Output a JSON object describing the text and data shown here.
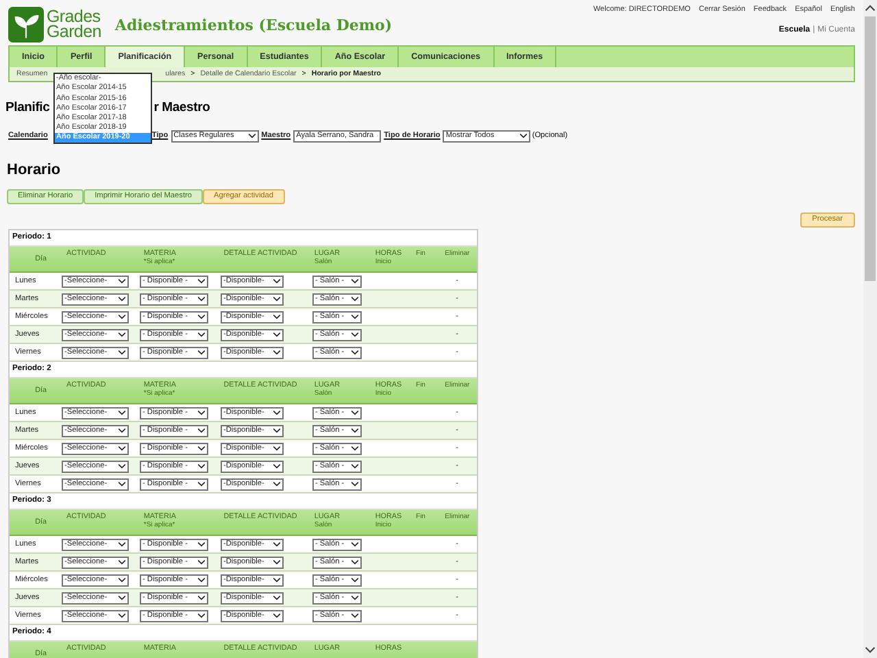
{
  "header": {
    "logo_lines": [
      "Grades",
      "Garden"
    ],
    "school_title": "Adiestramientos (Escuela Demo)",
    "top_links": [
      "Welcome: DIRECTORDEMO",
      "Cerrar Sesión",
      "Feedback",
      "Español",
      "English"
    ],
    "account_links": [
      {
        "text": "Escuela",
        "selected": true
      },
      {
        "text": "|",
        "selected": false
      },
      {
        "text": "Mi Cuenta",
        "selected": false
      }
    ]
  },
  "nav": {
    "tabs": [
      {
        "label": "Inicio",
        "selected": false
      },
      {
        "label": "Perfil",
        "selected": false
      },
      {
        "label": "Planificación",
        "selected": true
      },
      {
        "label": "Personal",
        "selected": false
      },
      {
        "label": "Estudiantes",
        "selected": false
      },
      {
        "label": "Año Escolar",
        "selected": false
      },
      {
        "label": "Comunicaciones",
        "selected": false
      },
      {
        "label": "Informes",
        "selected": false
      }
    ]
  },
  "breadcrumb": [
    {
      "text": "Resumen",
      "kind": "link"
    },
    {
      "text": "ulares",
      "kind": "link"
    },
    {
      "text": ">",
      "kind": "separator"
    },
    {
      "text": "Detalle de Calendario Escolar",
      "kind": "link"
    },
    {
      "text": ">",
      "kind": "separator"
    },
    {
      "text": "Horario por Maestro",
      "kind": "current"
    }
  ],
  "calendar_dropdown": {
    "options": [
      {
        "label": "-Año escolar-",
        "selected": false
      },
      {
        "label": "Año Escolar 2014-15",
        "selected": false
      },
      {
        "label": "Año Escolar 2015-16",
        "selected": false
      },
      {
        "label": "Año Escolar 2016-17",
        "selected": false
      },
      {
        "label": "Año Escolar 2017-18",
        "selected": false
      },
      {
        "label": "Año Escolar 2018-19",
        "selected": false
      },
      {
        "label": "Año Escolar 2019-20",
        "selected": true
      }
    ]
  },
  "page_title_parts": [
    "Planific",
    "r Maestro"
  ],
  "filters": [
    {
      "label": "Calendario",
      "kind": "open"
    },
    {
      "label": "Tipo",
      "kind": "select",
      "value": "Clases Regulares"
    },
    {
      "label": "Maestro",
      "kind": "select",
      "value": "Ayala Serrano, Sandra"
    },
    {
      "label": "Tipo de Horario",
      "kind": "select",
      "value": "Mostrar Todos",
      "note": "(Opcional)"
    }
  ],
  "section_title": "Horario",
  "buttons": [
    {
      "label": "Eliminar Horario",
      "kind": "green"
    },
    {
      "label": "Imprimir Horario del Maestro",
      "kind": "green"
    },
    {
      "label": "Agregar actividad",
      "kind": "orange"
    }
  ],
  "process_button": "Procesar",
  "periods": [
    {
      "label": "Periodo: 1",
      "columns": [
        {
          "title": "Día"
        },
        {
          "title": "ACTIVIDAD"
        },
        {
          "title": "MATERIA",
          "subtitle": "*Si aplica*"
        },
        {
          "title": "DETALLE ACTIVIDAD"
        },
        {
          "title": "LUGAR",
          "subtitle": "Salón"
        },
        {
          "title": "HORAS",
          "subtitle": "Inicio"
        },
        {
          "subtitle": "Fin"
        },
        {
          "subtitle": "Eliminar"
        }
      ],
      "rows": [
        {
          "day": "Lunes",
          "actividad": "-Seleccione-",
          "materia": "- Disponible -",
          "detalle": "-Disponible-",
          "lugar": "- Salón -",
          "eliminar": "-"
        },
        {
          "day": "Martes",
          "actividad": "-Seleccione-",
          "materia": "- Disponible -",
          "detalle": "-Disponible-",
          "lugar": "- Salón -",
          "eliminar": "-"
        },
        {
          "day": "Miércoles",
          "actividad": "-Seleccione-",
          "materia": "- Disponible -",
          "detalle": "-Disponible-",
          "lugar": "- Salón -",
          "eliminar": "-"
        },
        {
          "day": "Jueves",
          "actividad": "-Seleccione-",
          "materia": "- Disponible -",
          "detalle": "-Disponible-",
          "lugar": "- Salón -",
          "eliminar": "-"
        },
        {
          "day": "Viernes",
          "actividad": "-Seleccione-",
          "materia": "- Disponible -",
          "detalle": "-Disponible-",
          "lugar": "- Salón -",
          "eliminar": "-"
        }
      ]
    },
    {
      "label": "Periodo: 2",
      "columns": [
        {
          "title": "Día"
        },
        {
          "title": "ACTIVIDAD"
        },
        {
          "title": "MATERIA",
          "subtitle": "*Si aplica*"
        },
        {
          "title": "DETALLE ACTIVIDAD"
        },
        {
          "title": "LUGAR",
          "subtitle": "Salón"
        },
        {
          "title": "HORAS",
          "subtitle": "Inicio"
        },
        {
          "subtitle": "Fin"
        },
        {
          "subtitle": "Eliminar"
        }
      ],
      "rows": [
        {
          "day": "Lunes",
          "actividad": "-Seleccione-",
          "materia": "- Disponible -",
          "detalle": "-Disponible-",
          "lugar": "- Salón -",
          "eliminar": "-"
        },
        {
          "day": "Martes",
          "actividad": "-Seleccione-",
          "materia": "- Disponible -",
          "detalle": "-Disponible-",
          "lugar": "- Salón -",
          "eliminar": "-"
        },
        {
          "day": "Miércoles",
          "actividad": "-Seleccione-",
          "materia": "- Disponible -",
          "detalle": "-Disponible-",
          "lugar": "- Salón -",
          "eliminar": "-"
        },
        {
          "day": "Jueves",
          "actividad": "-Seleccione-",
          "materia": "- Disponible -",
          "detalle": "-Disponible-",
          "lugar": "- Salón -",
          "eliminar": "-"
        },
        {
          "day": "Viernes",
          "actividad": "-Seleccione-",
          "materia": "- Disponible -",
          "detalle": "-Disponible-",
          "lugar": "- Salón -",
          "eliminar": "-"
        }
      ]
    },
    {
      "label": "Periodo: 3",
      "columns": [
        {
          "title": "Día"
        },
        {
          "title": "ACTIVIDAD"
        },
        {
          "title": "MATERIA",
          "subtitle": "*Si aplica*"
        },
        {
          "title": "DETALLE ACTIVIDAD"
        },
        {
          "title": "LUGAR",
          "subtitle": "Salón"
        },
        {
          "title": "HORAS",
          "subtitle": "Inicio"
        },
        {
          "subtitle": "Fin"
        },
        {
          "subtitle": "Eliminar"
        }
      ],
      "rows": [
        {
          "day": "Lunes",
          "actividad": "-Seleccione-",
          "materia": "- Disponible -",
          "detalle": "-Disponible-",
          "lugar": "- Salón -",
          "eliminar": "-"
        },
        {
          "day": "Martes",
          "actividad": "-Seleccione-",
          "materia": "- Disponible -",
          "detalle": "-Disponible-",
          "lugar": "- Salón -",
          "eliminar": "-"
        },
        {
          "day": "Miércoles",
          "actividad": "-Seleccione-",
          "materia": "- Disponible -",
          "detalle": "-Disponible-",
          "lugar": "- Salón -",
          "eliminar": "-"
        },
        {
          "day": "Jueves",
          "actividad": "-Seleccione-",
          "materia": "- Disponible -",
          "detalle": "-Disponible-",
          "lugar": "- Salón -",
          "eliminar": "-"
        },
        {
          "day": "Viernes",
          "actividad": "-Seleccione-",
          "materia": "- Disponible -",
          "detalle": "-Disponible-",
          "lugar": "- Salón -",
          "eliminar": "-"
        }
      ]
    },
    {
      "label": "Periodo: 4",
      "columns": [
        {
          "title": "Día"
        },
        {
          "title": "ACTIVIDAD"
        },
        {
          "title": "MATERIA"
        },
        {
          "title": "DETALLE ACTIVIDAD"
        },
        {
          "title": "LUGAR"
        },
        {
          "title": "HORAS"
        },
        {},
        {}
      ]
    }
  ]
}
